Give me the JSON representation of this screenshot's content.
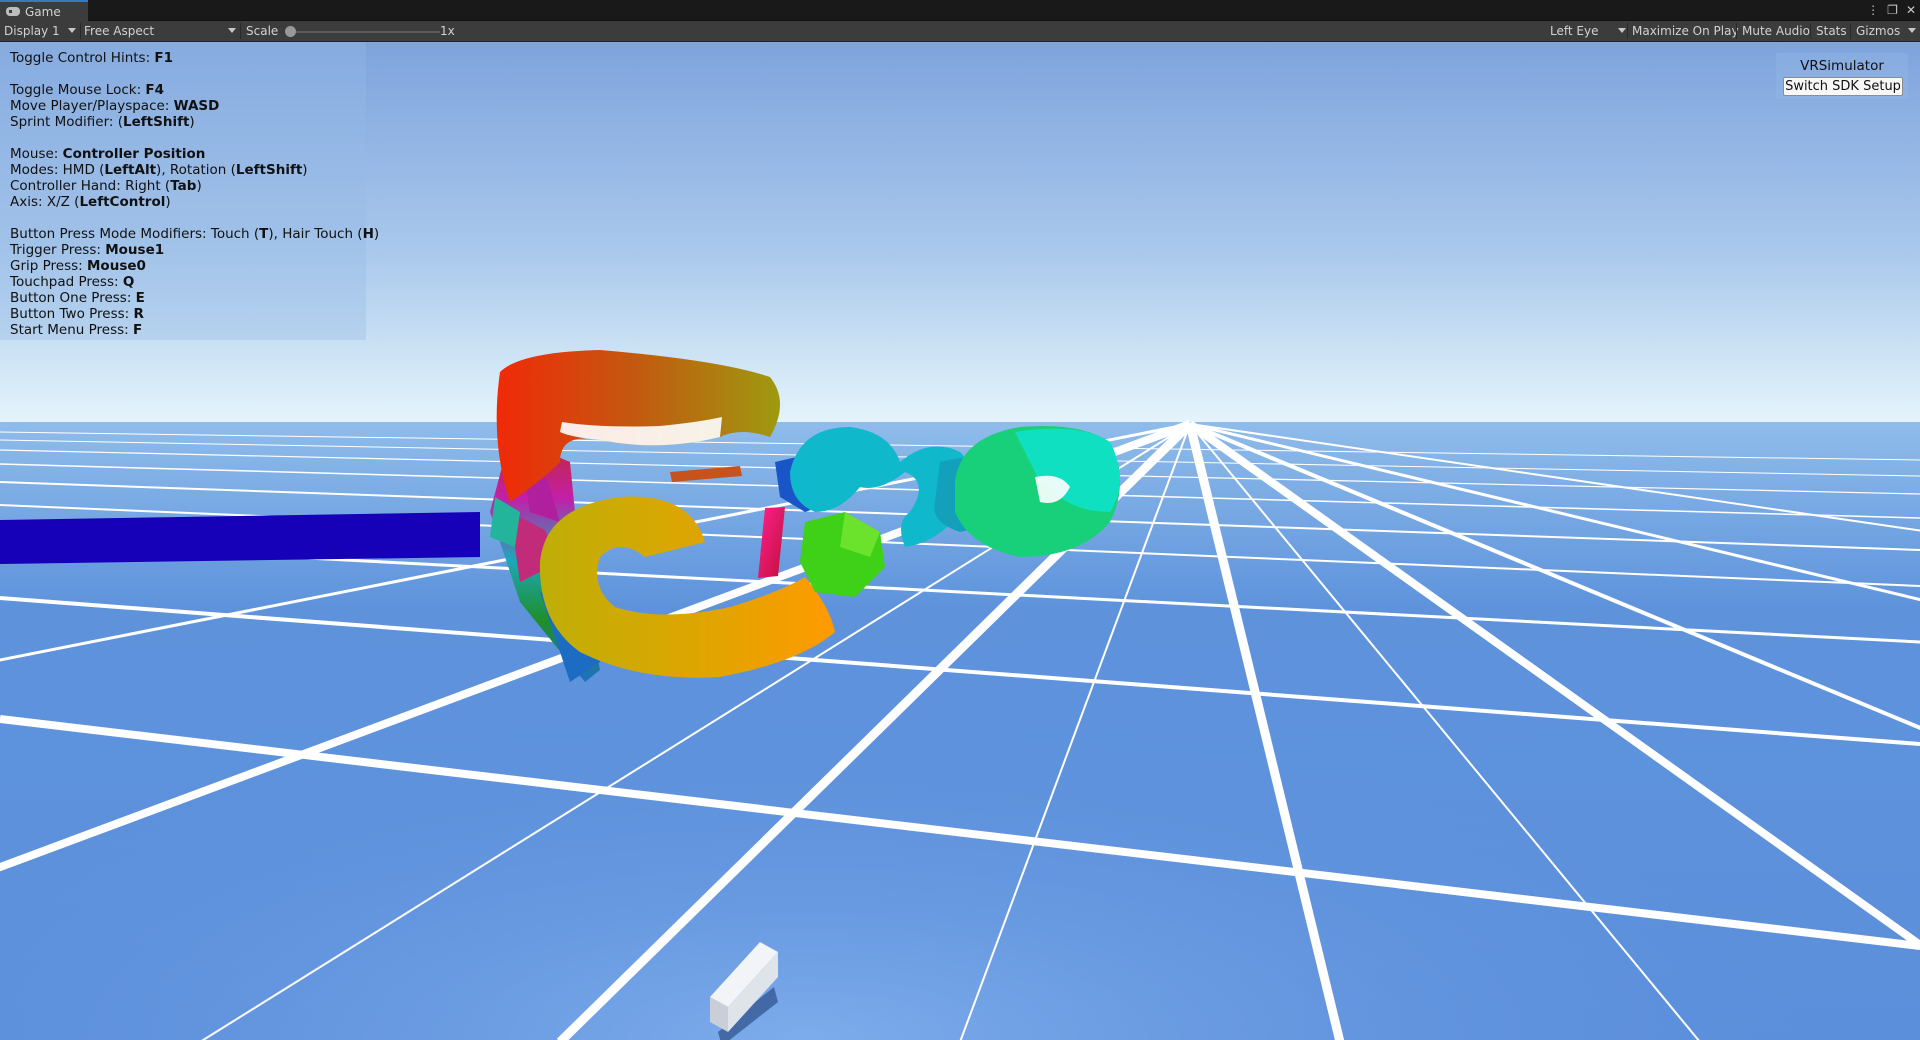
{
  "tab": {
    "title": "Game",
    "icon": "gamepad-icon"
  },
  "window_controls": {
    "menu": "⋮",
    "maximize": "❐",
    "close": "✕"
  },
  "toolbar": {
    "display": "Display 1",
    "aspect": "Free Aspect",
    "scale_label": "Scale",
    "scale_value": "1x",
    "eye": "Left Eye",
    "maximize": "Maximize On Play",
    "mute": "Mute Audio",
    "stats": "Stats",
    "gizmos": "Gizmos"
  },
  "hints": {
    "toggle_hints": {
      "label": "Toggle Control Hints: ",
      "key": "F1"
    },
    "mouse_lock": {
      "label": "Toggle Mouse Lock: ",
      "key": "F4"
    },
    "move": {
      "label": "Move Player/Playspace: ",
      "key": "WASD"
    },
    "sprint": {
      "label": "Sprint Modifier: (",
      "key": "LeftShift",
      "suffix": ")"
    },
    "mouse": {
      "label": "Mouse: ",
      "key": "Controller Position"
    },
    "modes": {
      "a": "Modes: HMD (",
      "k1": "LeftAlt",
      "b": "), Rotation (",
      "k2": "LeftShift",
      "c": ")"
    },
    "hand": {
      "a": "Controller Hand: Right (",
      "k": "Tab",
      "c": ")"
    },
    "axis": {
      "a": "Axis: X/Z (",
      "k": "LeftControl",
      "c": ")"
    },
    "modifiers": {
      "a": "Button Press Mode Modifiers: Touch (",
      "k1": "T",
      "b": "), Hair Touch (",
      "k2": "H",
      "c": ")"
    },
    "trigger": {
      "label": "Trigger Press: ",
      "key": "Mouse1"
    },
    "grip": {
      "label": "Grip Press: ",
      "key": "Mouse0"
    },
    "touchpad": {
      "label": "Touchpad Press: ",
      "key": "Q"
    },
    "button_one": {
      "label": "Button One Press: ",
      "key": "E"
    },
    "button_two": {
      "label": "Button Two Press: ",
      "key": "R"
    },
    "start_menu": {
      "label": "Start Menu Press: ",
      "key": "F"
    }
  },
  "vr_panel": {
    "title": "VRSimulator",
    "button": "Switch SDK Setup"
  },
  "colors": {
    "sky_top": "#7ea3dd",
    "sky_horizon": "#dff2fb",
    "floor": "#5f94de",
    "grid": "#ffffff",
    "toolbar_bg": "#3c3c3c"
  }
}
